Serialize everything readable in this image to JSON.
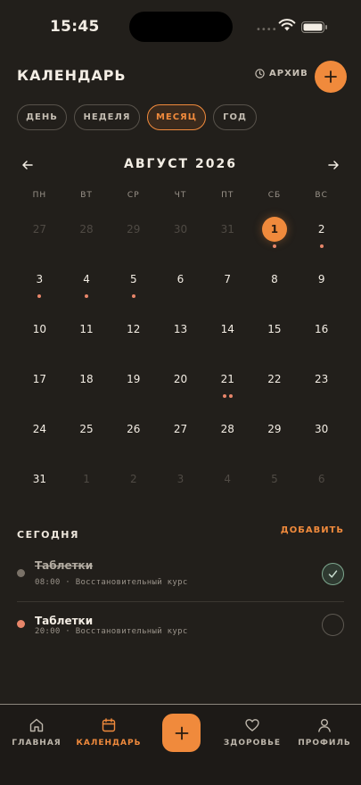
{
  "status_bar": {
    "time": "15:45",
    "signal": "••••"
  },
  "header": {
    "title": "КАЛЕНДАРЬ",
    "archive_label": "АРХИВ"
  },
  "view_tabs": [
    {
      "label": "ДЕНЬ",
      "active": false
    },
    {
      "label": "НЕДЕЛЯ",
      "active": false
    },
    {
      "label": "МЕСЯЦ",
      "active": true
    },
    {
      "label": "ГОД",
      "active": false
    }
  ],
  "calendar": {
    "month_label": "АВГУСТ 2026",
    "weekdays": [
      "ПН",
      "ВТ",
      "СР",
      "ЧТ",
      "ПТ",
      "СБ",
      "ВС"
    ],
    "days": [
      {
        "n": "27",
        "other": true
      },
      {
        "n": "28",
        "other": true
      },
      {
        "n": "29",
        "other": true
      },
      {
        "n": "30",
        "other": true
      },
      {
        "n": "31",
        "other": true
      },
      {
        "n": "1",
        "today": true,
        "dots": 1
      },
      {
        "n": "2",
        "dots": 1
      },
      {
        "n": "3",
        "dots": 1
      },
      {
        "n": "4",
        "dots": 1
      },
      {
        "n": "5",
        "dots": 1
      },
      {
        "n": "6"
      },
      {
        "n": "7"
      },
      {
        "n": "8"
      },
      {
        "n": "9"
      },
      {
        "n": "10"
      },
      {
        "n": "11"
      },
      {
        "n": "12"
      },
      {
        "n": "13"
      },
      {
        "n": "14"
      },
      {
        "n": "15"
      },
      {
        "n": "16"
      },
      {
        "n": "17"
      },
      {
        "n": "18"
      },
      {
        "n": "19"
      },
      {
        "n": "20"
      },
      {
        "n": "21",
        "dots": 2
      },
      {
        "n": "22"
      },
      {
        "n": "23"
      },
      {
        "n": "24"
      },
      {
        "n": "25"
      },
      {
        "n": "26"
      },
      {
        "n": "27"
      },
      {
        "n": "28"
      },
      {
        "n": "29"
      },
      {
        "n": "30"
      },
      {
        "n": "31"
      },
      {
        "n": "1",
        "other": true
      },
      {
        "n": "2",
        "other": true
      },
      {
        "n": "3",
        "other": true
      },
      {
        "n": "4",
        "other": true
      },
      {
        "n": "5",
        "other": true
      },
      {
        "n": "6",
        "other": true
      }
    ]
  },
  "today": {
    "title": "СЕГОДНЯ",
    "add_label": "ДОБАВИТЬ",
    "items": [
      {
        "title": "Таблетки",
        "time": "08:00",
        "course": "Восстановительный курс",
        "done": true,
        "marker_color": "#7a7268"
      },
      {
        "title": "Таблетки",
        "time": "20:00",
        "course": "Восстановительный курс",
        "done": false,
        "marker_color": "#e8866a"
      }
    ]
  },
  "bottom_nav": [
    {
      "label": "ГЛАВНАЯ",
      "icon": "home-icon",
      "active": false
    },
    {
      "label": "КАЛЕНДАРЬ",
      "icon": "calendar-icon",
      "active": true
    },
    {
      "label": "ЗДОРОВЬЕ",
      "icon": "heart-icon",
      "active": false
    },
    {
      "label": "ПРОФИЛЬ",
      "icon": "profile-icon",
      "active": false
    }
  ],
  "colors": {
    "accent": "#f08a3c",
    "background": "#221f1b",
    "event_dot": "#e8866a"
  }
}
